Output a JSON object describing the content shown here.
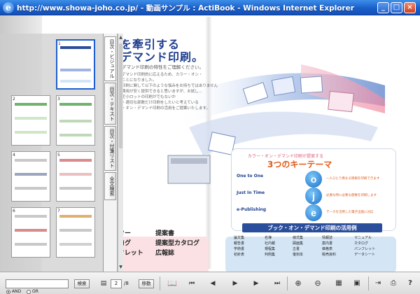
{
  "window": {
    "title": "http://www.showa-joho.co.jp/ - 動画サンプル : ActiBook - Windows Internet Explorer",
    "icon": "ie-icon",
    "buttons": [
      "minimize",
      "maximize",
      "close"
    ]
  },
  "page": {
    "heading_line1": "を牽引する",
    "heading_line2": "デマンド印刷。",
    "subtitle": "デマンド印刷の特性をご理解ください。",
    "body_lines": [
      "デマンド印刷的に応えるため、カラー・オン・",
      "ことになりました。",
      "印刷に関して以下のような悩みをお持ちではありません",
      "費用が安く提供できると思いますが、お試し...",
      "で小ロットの印刷がでもないか",
      "・適切な部数だけ印刷をしたいと考えている",
      "・オン・デマンド印刷の活用をご提案いたします。"
    ]
  },
  "key_themes": {
    "small_heading": "カラー・オン・デマンド印刷が提案する",
    "heading": "3つのキーテーマ",
    "themes": [
      {
        "title": "One to One",
        "letter": "o",
        "text": "一人ひとり異なる情報を印刷できます"
      },
      {
        "title": "Just In Time",
        "letter": "j",
        "text": "必要な時に必要な部数を印刷します"
      },
      {
        "title": "e-Publishing",
        "letter": "e",
        "text": "データを活用した電子出版に対応"
      }
    ]
  },
  "products_left": [
    "スター",
    "提案書",
    "タログ",
    "提案型カタログ",
    "ンフレット",
    "広報誌"
  ],
  "applications": {
    "title": "ブック・オン・デマンド印刷の活用例",
    "items": [
      "論文集",
      "名簿",
      "様式集",
      "情報誌",
      "マニュアル",
      "報告書",
      "社内報",
      "図面集",
      "案内書",
      "カタログ",
      "学術書",
      "規程集",
      "古書",
      "価格表",
      "パンフレット",
      "初針表",
      "判例集",
      "復刻本",
      "販売資料",
      "データシート"
    ]
  },
  "thumbnails": [
    {
      "num": "1",
      "selected": true
    },
    {
      "num": "2",
      "selected": false
    },
    {
      "num": "3",
      "selected": false
    },
    {
      "num": "4",
      "selected": false
    },
    {
      "num": "5",
      "selected": false
    },
    {
      "num": "6",
      "selected": false
    },
    {
      "num": "7",
      "selected": false
    }
  ],
  "side_tabs": [
    "目次・ビジュアル",
    "目次・テキスト",
    "目次・付箋リスト",
    "全文検索"
  ],
  "toolbar": {
    "search_button": "検索",
    "radio_and": "AND",
    "radio_or": "OR",
    "radio_selected": "AND",
    "current_page": "2",
    "total_pages": "/8",
    "go_button": "移動",
    "icons": [
      "book-icon",
      "first-page-icon",
      "prev-page-icon",
      "play-icon",
      "next-page-icon",
      "last-page-icon",
      "zoom-in-icon",
      "zoom-out-icon",
      "thumbnails-icon",
      "fit-icon",
      "export-icon",
      "print-icon",
      "help-icon"
    ]
  }
}
